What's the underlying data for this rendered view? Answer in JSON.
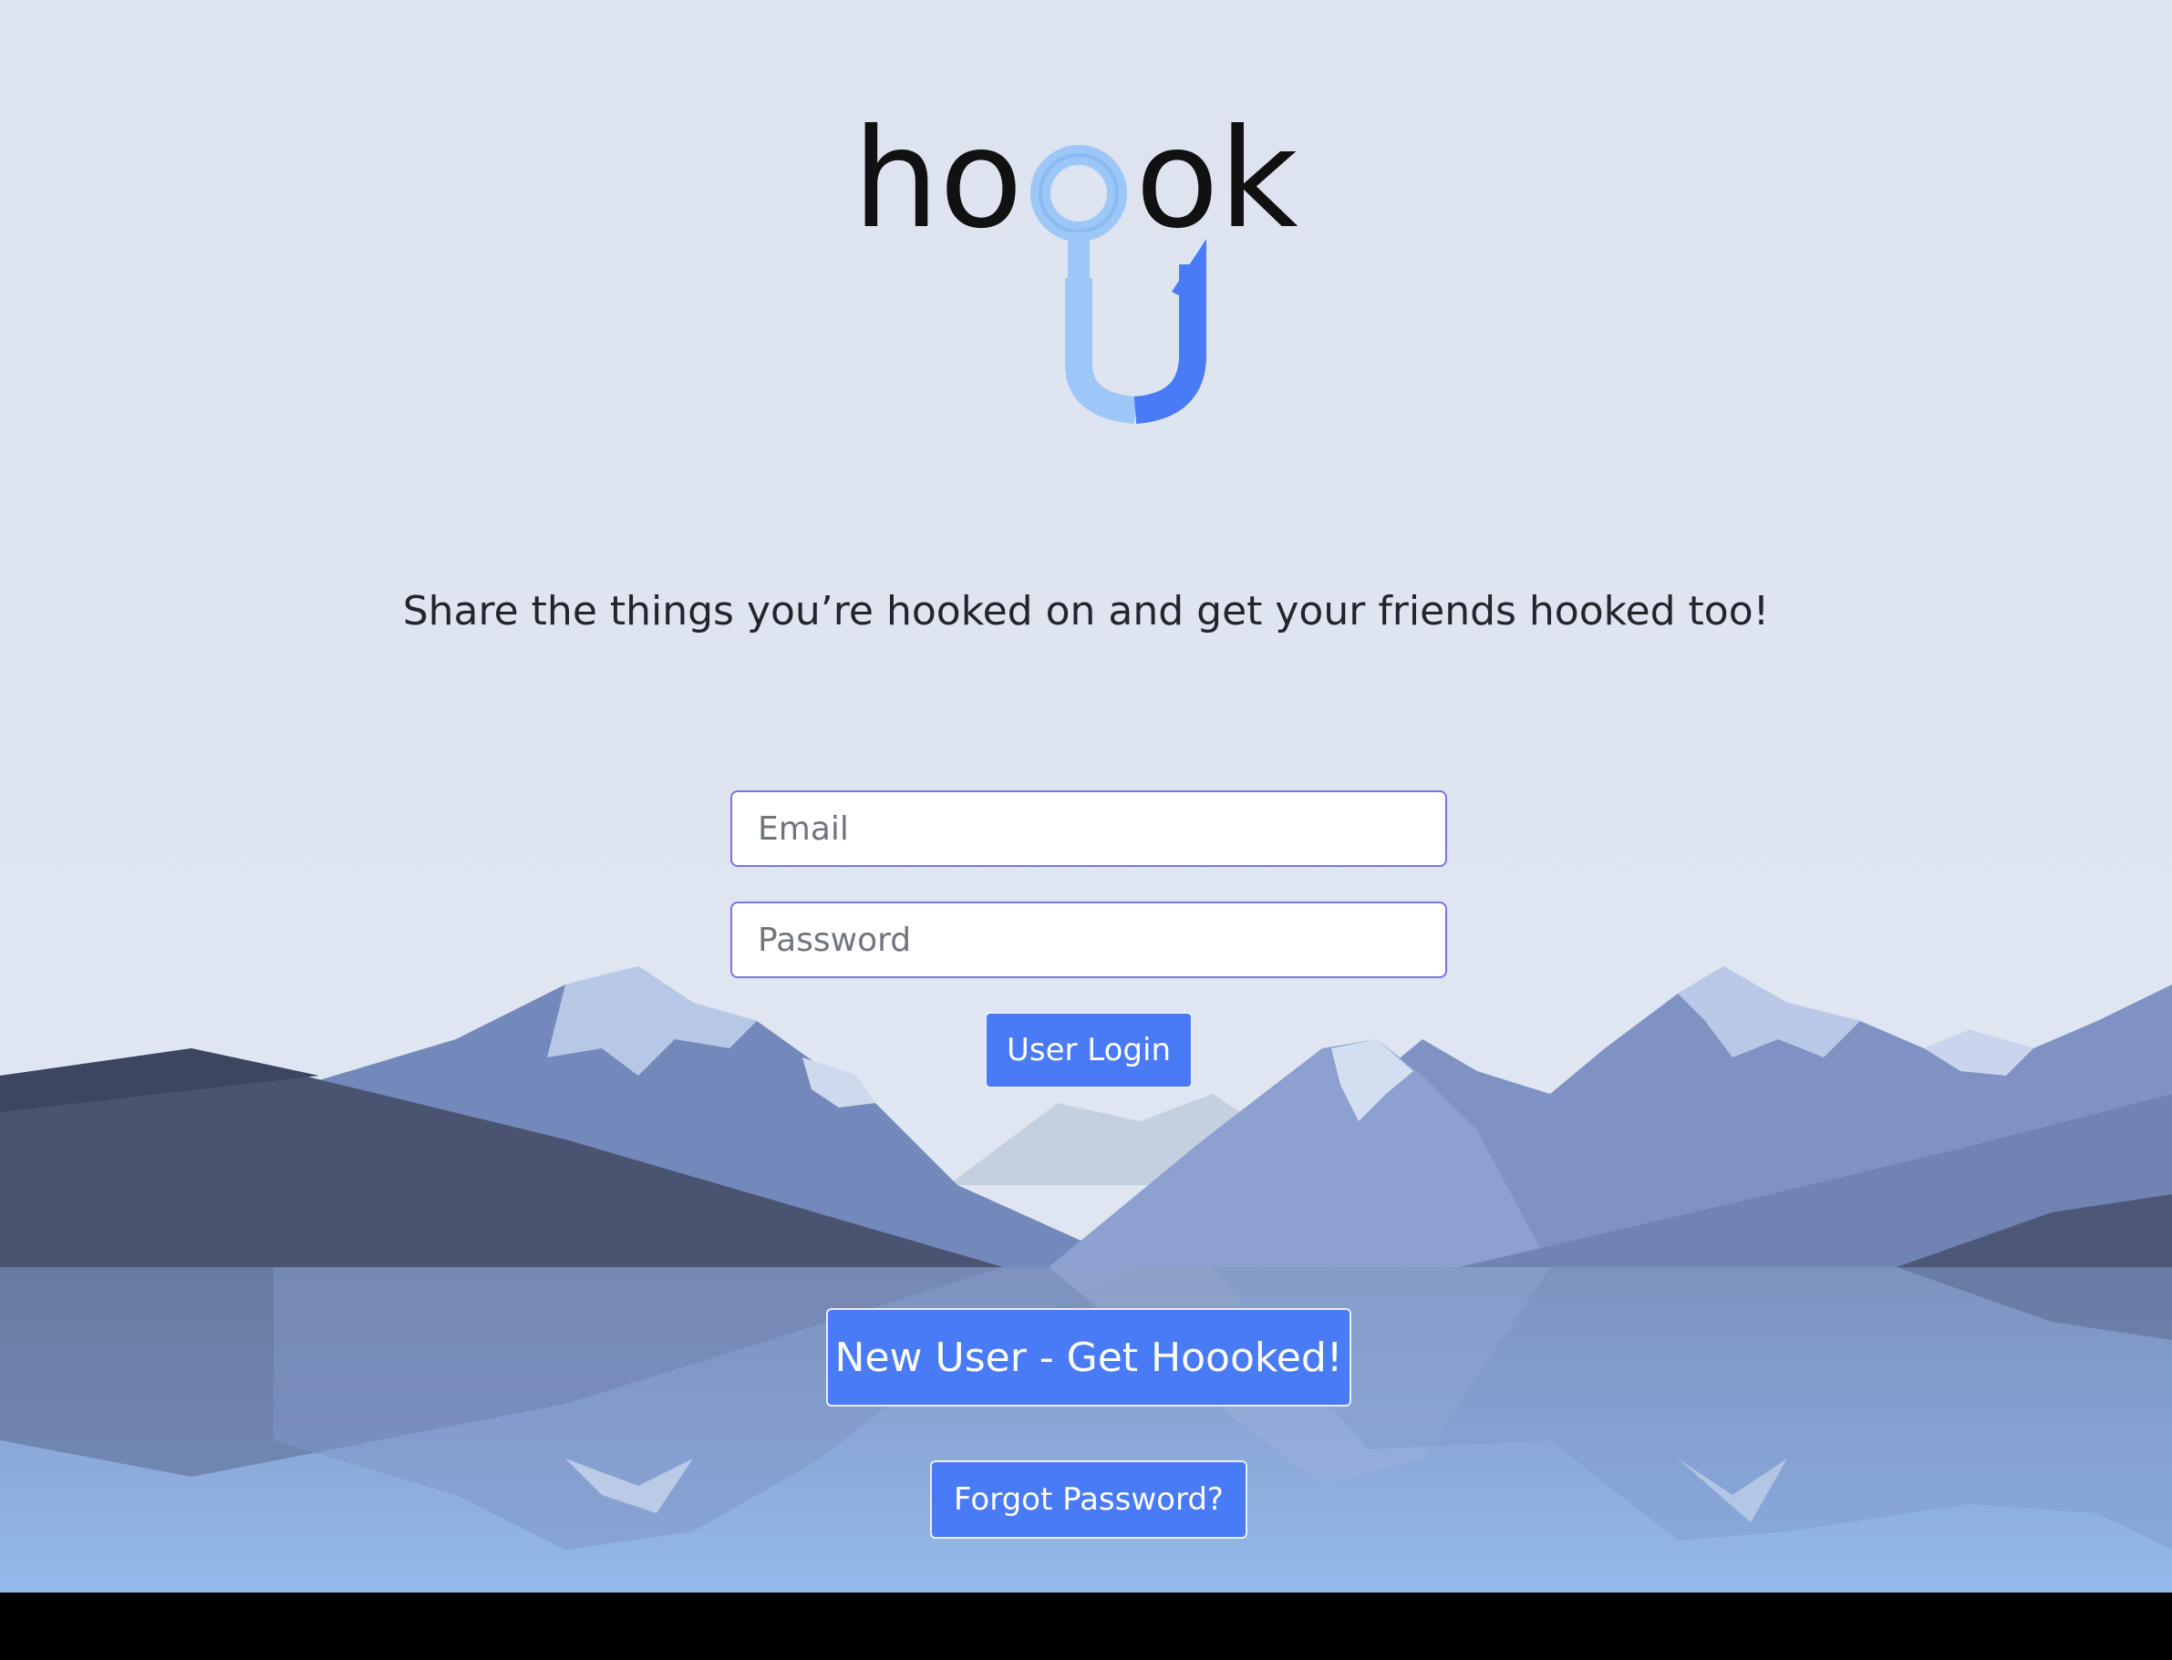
{
  "logo": {
    "text": "hooook",
    "icon": "fishing-hook-icon",
    "colors": {
      "text": "#111111",
      "hook_light": "#9cc7f7",
      "hook_dark": "#4a7bf7"
    }
  },
  "tagline": "Share the things you’re hooked on and get your friends hooked too!",
  "login_form": {
    "email_placeholder": "Email",
    "password_placeholder": "Password",
    "login_label": "User Login"
  },
  "signup_label": "New User - Get Hoooked!",
  "forgot_label": "Forgot Password?",
  "background": {
    "description_icon": "mountain-lake-illustration",
    "sky": "#dde4f0",
    "water": "#8fb4e6"
  },
  "colors": {
    "accent": "#4a7bf7",
    "input_border": "#7b73e6"
  }
}
